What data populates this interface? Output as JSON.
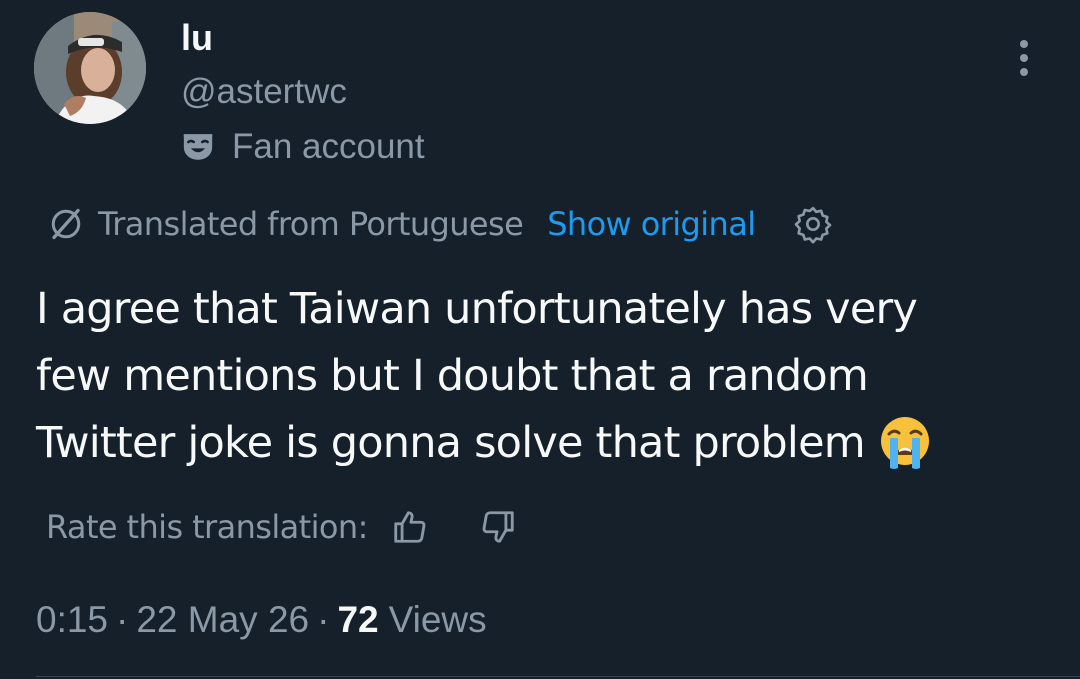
{
  "author": {
    "display_name": "lu",
    "handle": "@astertwc",
    "label": "Fan account",
    "label_icon": "theater-mask-icon"
  },
  "translation": {
    "notice": "Translated from Portuguese",
    "show_original": "Show original",
    "settings_icon": "gear-icon",
    "rate_label": "Rate this translation:"
  },
  "tweet": {
    "text": "I agree that Taiwan unfortunately has very\nfew mentions but I doubt that a random\nTwitter joke is gonna solve that problem",
    "emoji": "loudly-crying-face"
  },
  "meta": {
    "time": "0:15",
    "separator": "·",
    "date": "22 May 26",
    "views_count": "72",
    "views_label": "Views"
  },
  "colors": {
    "background": "#15202b",
    "text_primary": "#f7f9f9",
    "text_secondary": "#8b98a5",
    "link": "#1d9bf0"
  }
}
